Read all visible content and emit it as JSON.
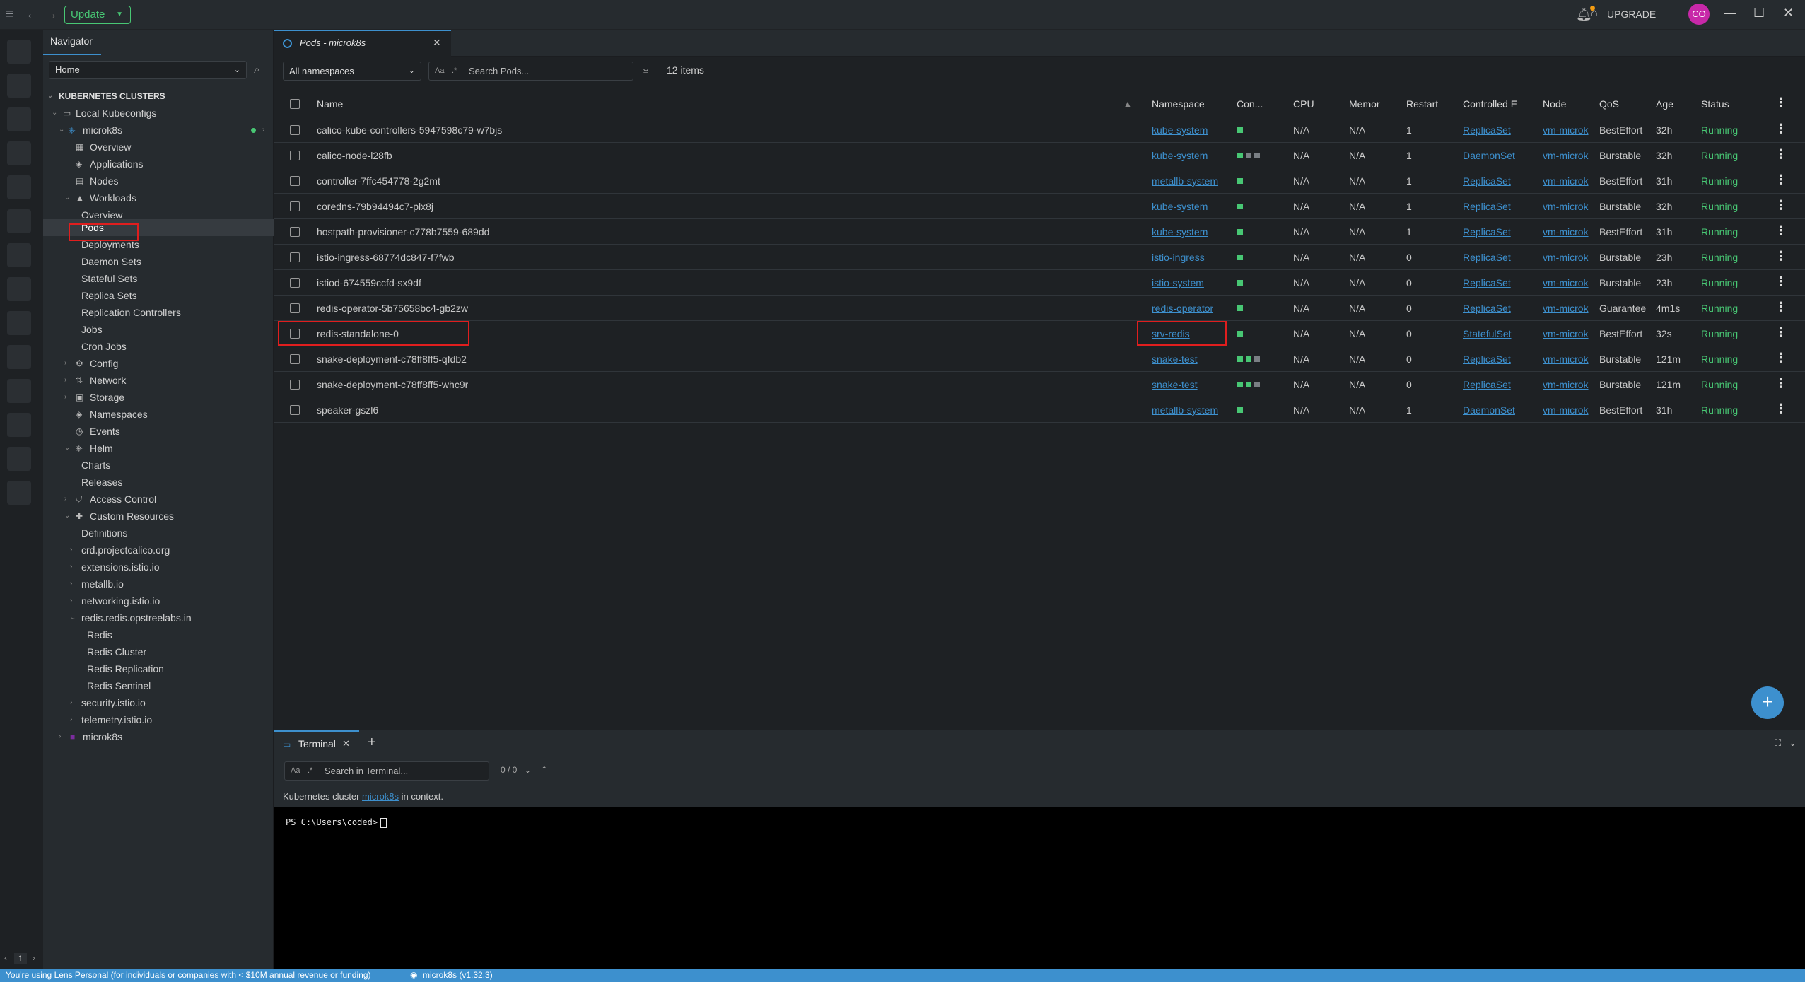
{
  "topbar": {
    "update_label": "Update",
    "upgrade_label": "UPGRADE",
    "avatar_initials": "CO"
  },
  "navigator": {
    "title": "Navigator",
    "workspace": "Home",
    "clusters_header": "KUBERNETES CLUSTERS",
    "local_kubeconfigs": "Local Kubeconfigs",
    "cluster_name": "microk8s",
    "items": {
      "overview": "Overview",
      "applications": "Applications",
      "nodes": "Nodes",
      "workloads": "Workloads",
      "wl_overview": "Overview",
      "pods": "Pods",
      "deployments": "Deployments",
      "daemon_sets": "Daemon Sets",
      "stateful_sets": "Stateful Sets",
      "replica_sets": "Replica Sets",
      "replication_controllers": "Replication Controllers",
      "jobs": "Jobs",
      "cron_jobs": "Cron Jobs",
      "config": "Config",
      "network": "Network",
      "storage": "Storage",
      "namespaces": "Namespaces",
      "events": "Events",
      "helm": "Helm",
      "charts": "Charts",
      "releases": "Releases",
      "access_control": "Access Control",
      "custom_resources": "Custom Resources",
      "definitions": "Definitions",
      "crd_calico": "crd.projectcalico.org",
      "ext_istio": "extensions.istio.io",
      "metallb": "metallb.io",
      "networking_istio": "networking.istio.io",
      "redis_ops": "redis.redis.opstreelabs.in",
      "redis": "Redis",
      "redis_cluster": "Redis Cluster",
      "redis_replication": "Redis Replication",
      "redis_sentinel": "Redis Sentinel",
      "security_istio": "security.istio.io",
      "telemetry_istio": "telemetry.istio.io",
      "microk8s_bottom": "microk8s"
    }
  },
  "tab": {
    "title": "Pods - microk8s"
  },
  "toolbar": {
    "namespace_select": "All namespaces",
    "search_placeholder": "Search Pods...",
    "search_aa": "Aa",
    "search_regex": ".*",
    "items_count": "12 items"
  },
  "table": {
    "headers": {
      "name": "Name",
      "namespace": "Namespace",
      "containers": "Con...",
      "cpu": "CPU",
      "memory": "Memor",
      "restarts": "Restart",
      "controlled_by": "Controlled E",
      "node": "Node",
      "qos": "QoS",
      "age": "Age",
      "status": "Status"
    },
    "rows": [
      {
        "name": "calico-kube-controllers-5947598c79-w7bjs",
        "namespace": "kube-system",
        "cpu": "N/A",
        "memory": "N/A",
        "restarts": "1",
        "controlled_by": "ReplicaSet",
        "node": "vm-microk",
        "qos": "BestEffort",
        "age": "32h",
        "status": "Running",
        "containers": [
          "#48c774"
        ]
      },
      {
        "name": "calico-node-l28fb",
        "namespace": "kube-system",
        "cpu": "N/A",
        "memory": "N/A",
        "restarts": "1",
        "controlled_by": "DaemonSet",
        "node": "vm-microk",
        "qos": "Burstable",
        "age": "32h",
        "status": "Running",
        "containers": [
          "#48c774",
          "#7a7f84",
          "#7a7f84"
        ]
      },
      {
        "name": "controller-7ffc454778-2g2mt",
        "namespace": "metallb-system",
        "cpu": "N/A",
        "memory": "N/A",
        "restarts": "1",
        "controlled_by": "ReplicaSet",
        "node": "vm-microk",
        "qos": "BestEffort",
        "age": "31h",
        "status": "Running",
        "containers": [
          "#48c774"
        ]
      },
      {
        "name": "coredns-79b94494c7-plx8j",
        "namespace": "kube-system",
        "cpu": "N/A",
        "memory": "N/A",
        "restarts": "1",
        "controlled_by": "ReplicaSet",
        "node": "vm-microk",
        "qos": "Burstable",
        "age": "32h",
        "status": "Running",
        "containers": [
          "#48c774"
        ]
      },
      {
        "name": "hostpath-provisioner-c778b7559-689dd",
        "namespace": "kube-system",
        "cpu": "N/A",
        "memory": "N/A",
        "restarts": "1",
        "controlled_by": "ReplicaSet",
        "node": "vm-microk",
        "qos": "BestEffort",
        "age": "31h",
        "status": "Running",
        "containers": [
          "#48c774"
        ]
      },
      {
        "name": "istio-ingress-68774dc847-f7fwb",
        "namespace": "istio-ingress",
        "cpu": "N/A",
        "memory": "N/A",
        "restarts": "0",
        "controlled_by": "ReplicaSet",
        "node": "vm-microk",
        "qos": "Burstable",
        "age": "23h",
        "status": "Running",
        "containers": [
          "#48c774"
        ]
      },
      {
        "name": "istiod-674559ccfd-sx9df",
        "namespace": "istio-system",
        "cpu": "N/A",
        "memory": "N/A",
        "restarts": "0",
        "controlled_by": "ReplicaSet",
        "node": "vm-microk",
        "qos": "Burstable",
        "age": "23h",
        "status": "Running",
        "containers": [
          "#48c774"
        ]
      },
      {
        "name": "redis-operator-5b75658bc4-gb2zw",
        "namespace": "redis-operator",
        "cpu": "N/A",
        "memory": "N/A",
        "restarts": "0",
        "controlled_by": "ReplicaSet",
        "node": "vm-microk",
        "qos": "Guarantee",
        "age": "4m1s",
        "status": "Running",
        "containers": [
          "#48c774"
        ]
      },
      {
        "name": "redis-standalone-0",
        "namespace": "srv-redis",
        "cpu": "N/A",
        "memory": "N/A",
        "restarts": "0",
        "controlled_by": "StatefulSet",
        "node": "vm-microk",
        "qos": "BestEffort",
        "age": "32s",
        "status": "Running",
        "containers": [
          "#48c774"
        ]
      },
      {
        "name": "snake-deployment-c78ff8ff5-qfdb2",
        "namespace": "snake-test",
        "cpu": "N/A",
        "memory": "N/A",
        "restarts": "0",
        "controlled_by": "ReplicaSet",
        "node": "vm-microk",
        "qos": "Burstable",
        "age": "121m",
        "status": "Running",
        "containers": [
          "#48c774",
          "#48c774",
          "#7a7f84"
        ]
      },
      {
        "name": "snake-deployment-c78ff8ff5-whc9r",
        "namespace": "snake-test",
        "cpu": "N/A",
        "memory": "N/A",
        "restarts": "0",
        "controlled_by": "ReplicaSet",
        "node": "vm-microk",
        "qos": "Burstable",
        "age": "121m",
        "status": "Running",
        "containers": [
          "#48c774",
          "#48c774",
          "#7a7f84"
        ]
      },
      {
        "name": "speaker-gszl6",
        "namespace": "metallb-system",
        "cpu": "N/A",
        "memory": "N/A",
        "restarts": "1",
        "controlled_by": "DaemonSet",
        "node": "vm-microk",
        "qos": "BestEffort",
        "age": "31h",
        "status": "Running",
        "containers": [
          "#48c774"
        ]
      }
    ]
  },
  "terminal": {
    "tab_label": "Terminal",
    "search_placeholder": "Search in Terminal...",
    "search_aa": "Aa",
    "search_regex": ".*",
    "match_count": "0 / 0",
    "info_prefix": "Kubernetes cluster",
    "info_cluster": "microk8s",
    "info_suffix": "in context.",
    "prompt": "PS C:\\Users\\coded>"
  },
  "hotbar": {
    "page_number": "1"
  },
  "statusbar": {
    "license_text": "You're using Lens Personal (for individuals or companies with < $10M annual revenue or funding)",
    "cluster_status": "microk8s (v1.32.3)"
  },
  "colors": {
    "accent": "#3d90ce",
    "running": "#48c774",
    "highlight_box": "#e01e1e"
  }
}
